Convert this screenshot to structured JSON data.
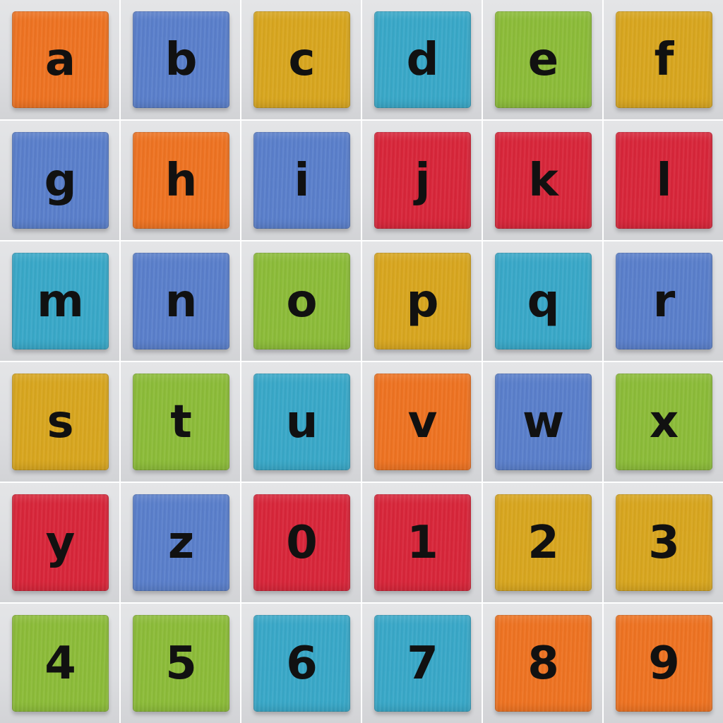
{
  "colors": {
    "orange": "#ee7322",
    "blue": "#5a7fcb",
    "mustard": "#d8a61f",
    "cyan": "#39a8c8",
    "green": "#8cbc39",
    "red": "#d8263a"
  },
  "blocks": [
    {
      "char": "a",
      "color": "orange"
    },
    {
      "char": "b",
      "color": "blue"
    },
    {
      "char": "c",
      "color": "mustard"
    },
    {
      "char": "d",
      "color": "cyan"
    },
    {
      "char": "e",
      "color": "green"
    },
    {
      "char": "f",
      "color": "mustard"
    },
    {
      "char": "g",
      "color": "blue"
    },
    {
      "char": "h",
      "color": "orange"
    },
    {
      "char": "i",
      "color": "blue"
    },
    {
      "char": "j",
      "color": "red"
    },
    {
      "char": "k",
      "color": "red"
    },
    {
      "char": "l",
      "color": "red"
    },
    {
      "char": "m",
      "color": "cyan"
    },
    {
      "char": "n",
      "color": "blue"
    },
    {
      "char": "o",
      "color": "green"
    },
    {
      "char": "p",
      "color": "mustard"
    },
    {
      "char": "q",
      "color": "cyan"
    },
    {
      "char": "r",
      "color": "blue"
    },
    {
      "char": "s",
      "color": "mustard"
    },
    {
      "char": "t",
      "color": "green"
    },
    {
      "char": "u",
      "color": "cyan"
    },
    {
      "char": "v",
      "color": "orange"
    },
    {
      "char": "w",
      "color": "blue"
    },
    {
      "char": "x",
      "color": "green"
    },
    {
      "char": "y",
      "color": "red"
    },
    {
      "char": "z",
      "color": "blue"
    },
    {
      "char": "0",
      "color": "red"
    },
    {
      "char": "1",
      "color": "red"
    },
    {
      "char": "2",
      "color": "mustard"
    },
    {
      "char": "3",
      "color": "mustard"
    },
    {
      "char": "4",
      "color": "green"
    },
    {
      "char": "5",
      "color": "green"
    },
    {
      "char": "6",
      "color": "cyan"
    },
    {
      "char": "7",
      "color": "cyan"
    },
    {
      "char": "8",
      "color": "orange"
    },
    {
      "char": "9",
      "color": "orange"
    }
  ]
}
